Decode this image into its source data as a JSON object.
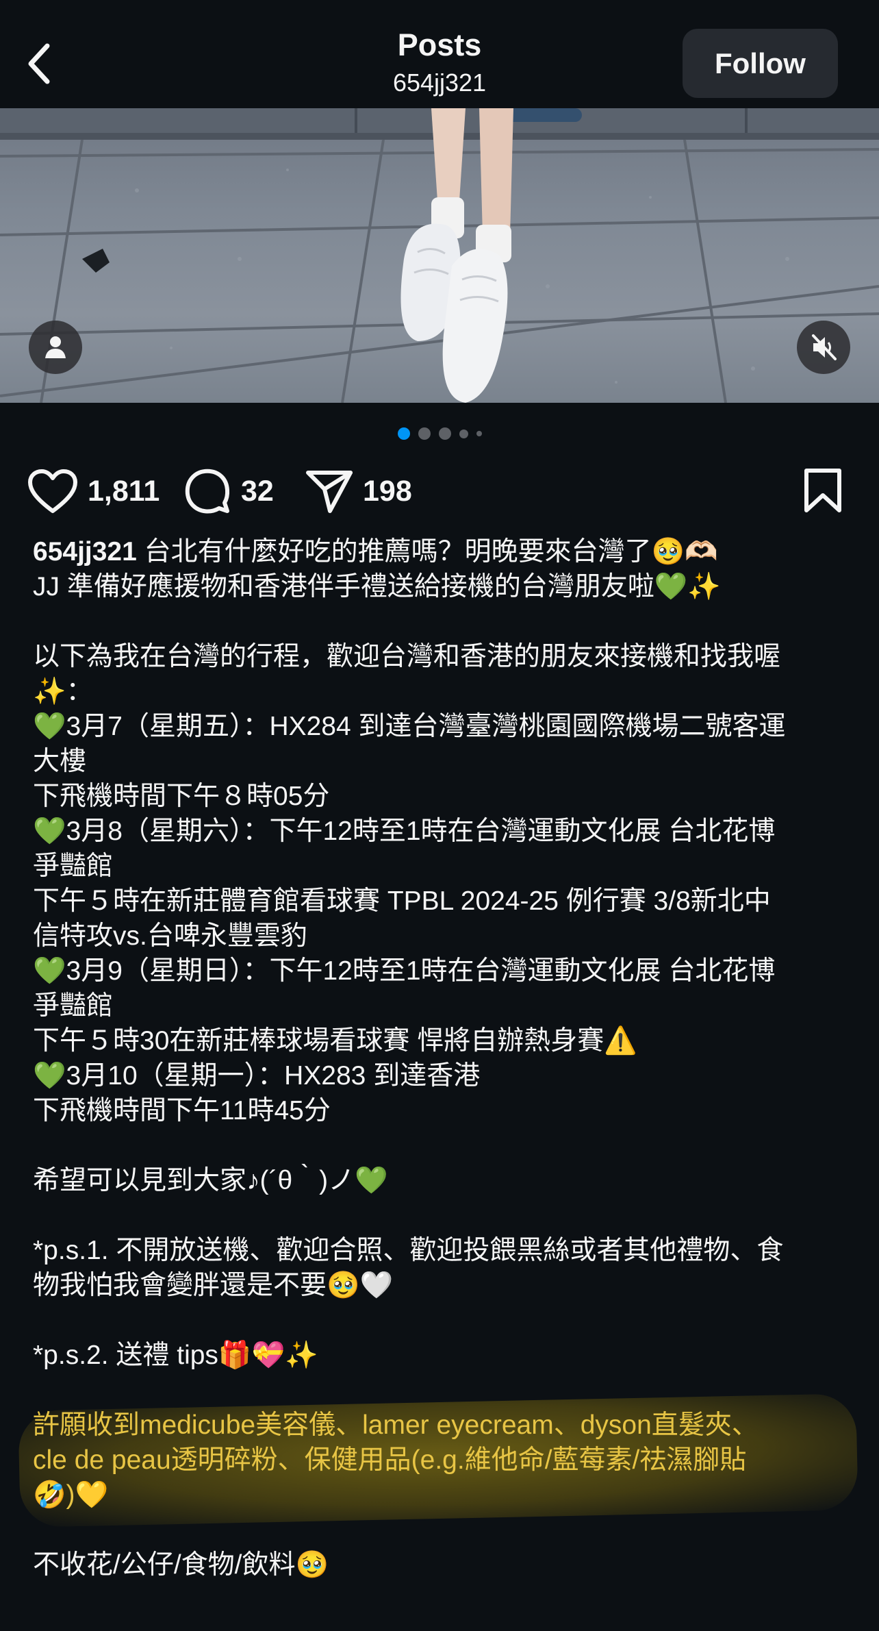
{
  "header": {
    "title": "Posts",
    "username": "654jj321",
    "follow_label": "Follow"
  },
  "carousel": {
    "total_slides": 5,
    "active_slide": 1
  },
  "actions": {
    "likes": "1,811",
    "comments": "32",
    "shares": "198"
  },
  "caption": {
    "username": "654jj321",
    "first_line": " 台北有什麼好吃的推薦嗎？明晚要來台灣了🥹🫶🏻",
    "lines": [
      "JJ 準備好應援物和香港伴手禮送給接機的台灣朋友啦💚✨",
      "",
      "以下為我在台灣的行程，歡迎台灣和香港的朋友來接機和找我喔",
      "✨：",
      "💚3月7（星期五）：HX284 到達台灣臺灣桃園國際機場二號客運",
      "大樓",
      "下飛機時間下午８時05分",
      "💚3月8（星期六）：下午12時至1時在台灣運動文化展 台北花博",
      "爭豔館",
      "下午５時在新莊體育館看球賽 TPBL 2024-25 例行賽 3/8新北中",
      "信特攻vs.台啤永豐雲豹",
      "💚3月9（星期日）：下午12時至1時在台灣運動文化展 台北花博",
      "爭豔館",
      "下午５時30在新莊棒球場看球賽 悍將自辦熱身賽⚠️",
      "💚3月10（星期一）：HX283 到達香港",
      "下飛機時間下午11時45分",
      "",
      "希望可以見到大家♪(´θ｀)ノ💚",
      "",
      "*p.s.1. 不開放送機、歡迎合照、歡迎投餵黑絲或者其他禮物、食",
      "物我怕我會變胖還是不要🥹🤍",
      "",
      "*p.s.2. 送禮 tips🎁💝✨",
      ""
    ],
    "highlight_lines": [
      "許願收到medicube美容儀、lamer eyecream、dyson直髮夾、",
      "cle de peau透明碎粉、保健用品(e.g.維他命/藍莓素/祛濕腳貼",
      "🤣)💛"
    ],
    "after_lines": [
      "",
      "不收花/公仔/食物/飲料🥹"
    ]
  },
  "colors": {
    "background": "#0c1014",
    "follow_button_bg": "#262a30",
    "active_dot": "#0095f6",
    "highlight_text": "#e8c545"
  },
  "icons": {
    "back": "chevron-left-icon",
    "user_tag": "user-icon",
    "mute": "speaker-muted-icon",
    "like": "heart-icon",
    "comment": "comment-bubble-icon",
    "share": "paper-plane-icon",
    "save": "bookmark-icon"
  }
}
